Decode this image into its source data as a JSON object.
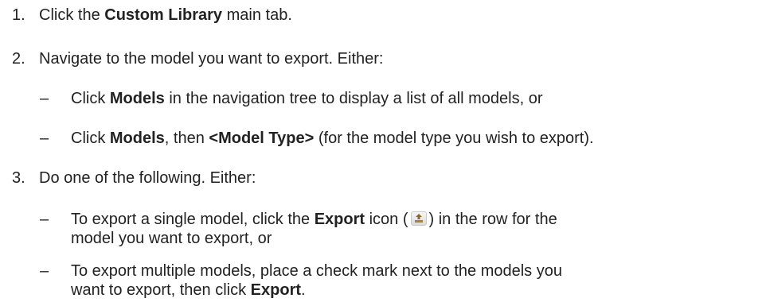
{
  "steps": [
    {
      "number": "1.",
      "pre": "Click the ",
      "bold": "Custom Library",
      "post": " main tab."
    },
    {
      "number": "2.",
      "text": "Navigate to the model you want to export. Either:",
      "items": [
        {
          "dash": "–",
          "pre": "Click ",
          "bold": "Models",
          "post": " in the navigation tree to display a list of all models, or"
        },
        {
          "dash": "–",
          "pre": "Click ",
          "bold": "Models",
          "mid": ", then ",
          "bold2": "<Model Type>",
          "post": " (for the model type you wish to export)."
        }
      ]
    },
    {
      "number": "3.",
      "text": "Do one of the following. Either:",
      "items": [
        {
          "dash": "–",
          "pre": "To export a single model, click the ",
          "bold": "Export",
          "mid": " icon (",
          "icon": "export-icon",
          "post": ") in the row for the",
          "line2": "model you want to export, or"
        },
        {
          "dash": "–",
          "line1": "To export multiple models, place a check mark next to the models you",
          "pre2": "want to export, then click ",
          "bold": "Export",
          "post": "."
        }
      ]
    }
  ]
}
